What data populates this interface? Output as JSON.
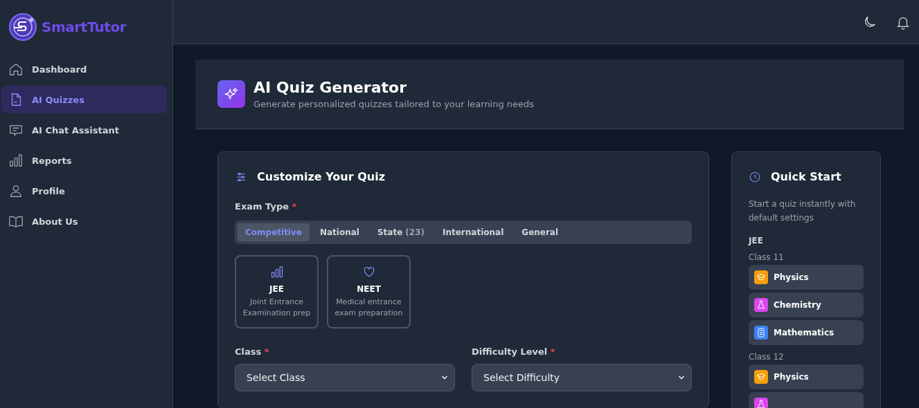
{
  "brand": {
    "name": "SmartTutor"
  },
  "sidebar": {
    "items": [
      {
        "label": "Dashboard",
        "selected": false
      },
      {
        "label": "AI Quizzes",
        "selected": true
      },
      {
        "label": "AI Chat Assistant",
        "selected": false
      },
      {
        "label": "Reports",
        "selected": false
      },
      {
        "label": "Profile",
        "selected": false
      },
      {
        "label": "About Us",
        "selected": false
      }
    ]
  },
  "hero": {
    "title": "AI Quiz Generator",
    "subtitle": "Generate personalized quizzes tailored to your learning needs"
  },
  "customize": {
    "title": "Customize Your Quiz",
    "exam_type_label": "Exam Type",
    "required_mark": "*",
    "tabs": [
      {
        "label": "Competitive",
        "selected": true
      },
      {
        "label": "National",
        "selected": false
      },
      {
        "label": "State",
        "count": "(23)",
        "selected": false
      },
      {
        "label": "International",
        "selected": false
      },
      {
        "label": "General",
        "selected": false
      }
    ],
    "exams": [
      {
        "name": "JEE",
        "description": "Joint Entrance Examination prep"
      },
      {
        "name": "NEET",
        "description": "Medical entrance exam preparation"
      }
    ],
    "fields": [
      {
        "label": "Class",
        "required_mark": "*",
        "value": "Select Class"
      },
      {
        "label": "Difficulty Level",
        "required_mark": "*",
        "value": "Select Difficulty"
      }
    ]
  },
  "quick_start": {
    "title": "Quick Start",
    "description": "Start a quiz instantly with default settings",
    "exam": "JEE",
    "groups": [
      {
        "label": "Class 11",
        "subjects": [
          {
            "label": "Physics",
            "color": "#f59e0b"
          },
          {
            "label": "Chemistry",
            "color": "#d946ef"
          },
          {
            "label": "Mathematics",
            "color": "#3b82f6"
          }
        ]
      },
      {
        "label": "Class 12",
        "subjects": [
          {
            "label": "Physics",
            "color": "#f59e0b"
          },
          {
            "color": "#d946ef"
          }
        ]
      }
    ]
  }
}
